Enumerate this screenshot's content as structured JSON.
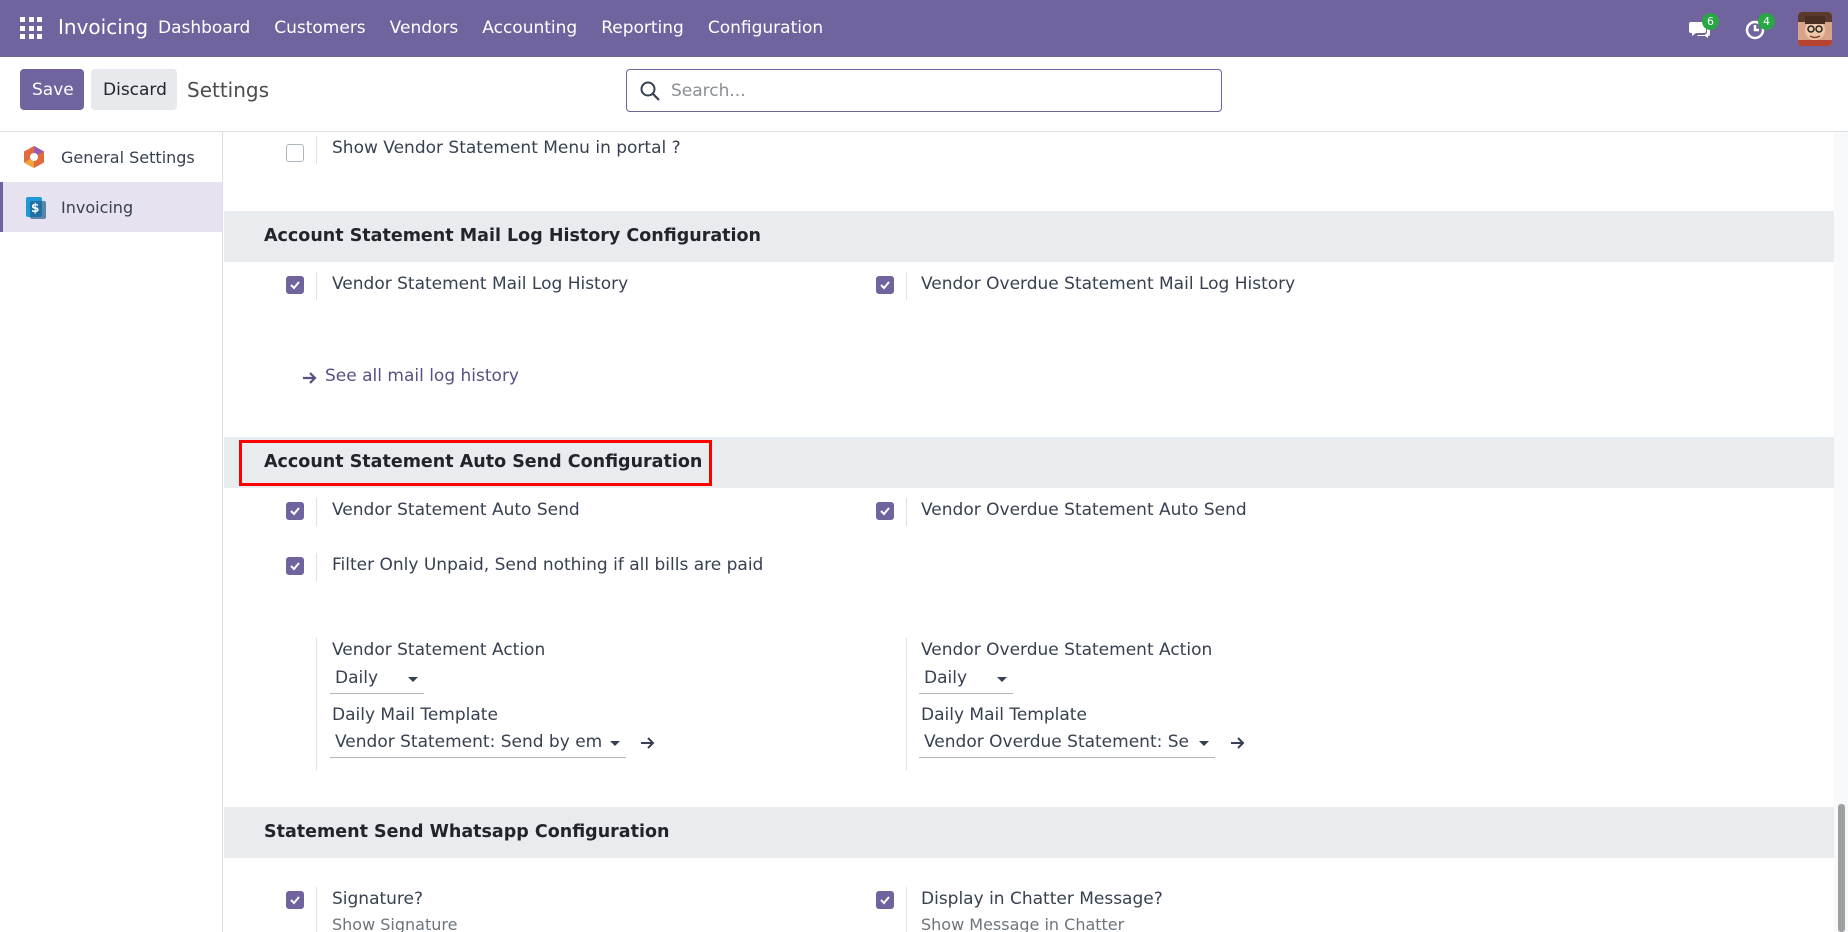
{
  "navbar": {
    "brand": "Invoicing",
    "menu": [
      "Dashboard",
      "Customers",
      "Vendors",
      "Accounting",
      "Reporting",
      "Configuration"
    ],
    "messages_count": "6",
    "activities_count": "4",
    "color": "#71639e"
  },
  "control": {
    "save_label": "Save",
    "discard_label": "Discard",
    "title": "Settings",
    "search_placeholder": "Search..."
  },
  "sidebar": {
    "items": [
      {
        "label": "General Settings",
        "icon": "general-settings-icon"
      },
      {
        "label": "Invoicing",
        "icon": "invoicing-icon",
        "active": true
      }
    ]
  },
  "content": {
    "portal_setting": {
      "label": "Show Vendor Statement Menu in portal ?",
      "checked": false
    },
    "mail_log_section": {
      "title": "Account Statement Mail Log History Configuration",
      "left": {
        "label": "Vendor Statement Mail Log History",
        "checked": true
      },
      "right": {
        "label": "Vendor Overdue Statement Mail Log History",
        "checked": true
      },
      "link": "See all mail log history"
    },
    "auto_send_section": {
      "title": "Account Statement Auto Send Configuration",
      "left": {
        "label": "Vendor Statement Auto Send",
        "checked": true
      },
      "right": {
        "label": "Vendor Overdue Statement Auto Send",
        "checked": true
      },
      "filter": {
        "label": "Filter Only Unpaid, Send nothing if all bills are paid",
        "checked": true
      },
      "left_action": {
        "label": "Vendor Statement Action",
        "value": "Daily",
        "template_label": "Daily Mail Template",
        "template_value": "Vendor Statement: Send by email"
      },
      "right_action": {
        "label": "Vendor Overdue Statement Action",
        "value": "Daily",
        "template_label": "Daily Mail Template",
        "template_value": "Vendor Overdue Statement: Send by email"
      }
    },
    "whatsapp_section": {
      "title": "Statement Send Whatsapp Configuration",
      "left": {
        "label": "Signature?",
        "sub": "Show Signature",
        "checked": true
      },
      "right": {
        "label": "Display in Chatter Message?",
        "sub": "Show Message in Chatter",
        "checked": true
      }
    }
  }
}
